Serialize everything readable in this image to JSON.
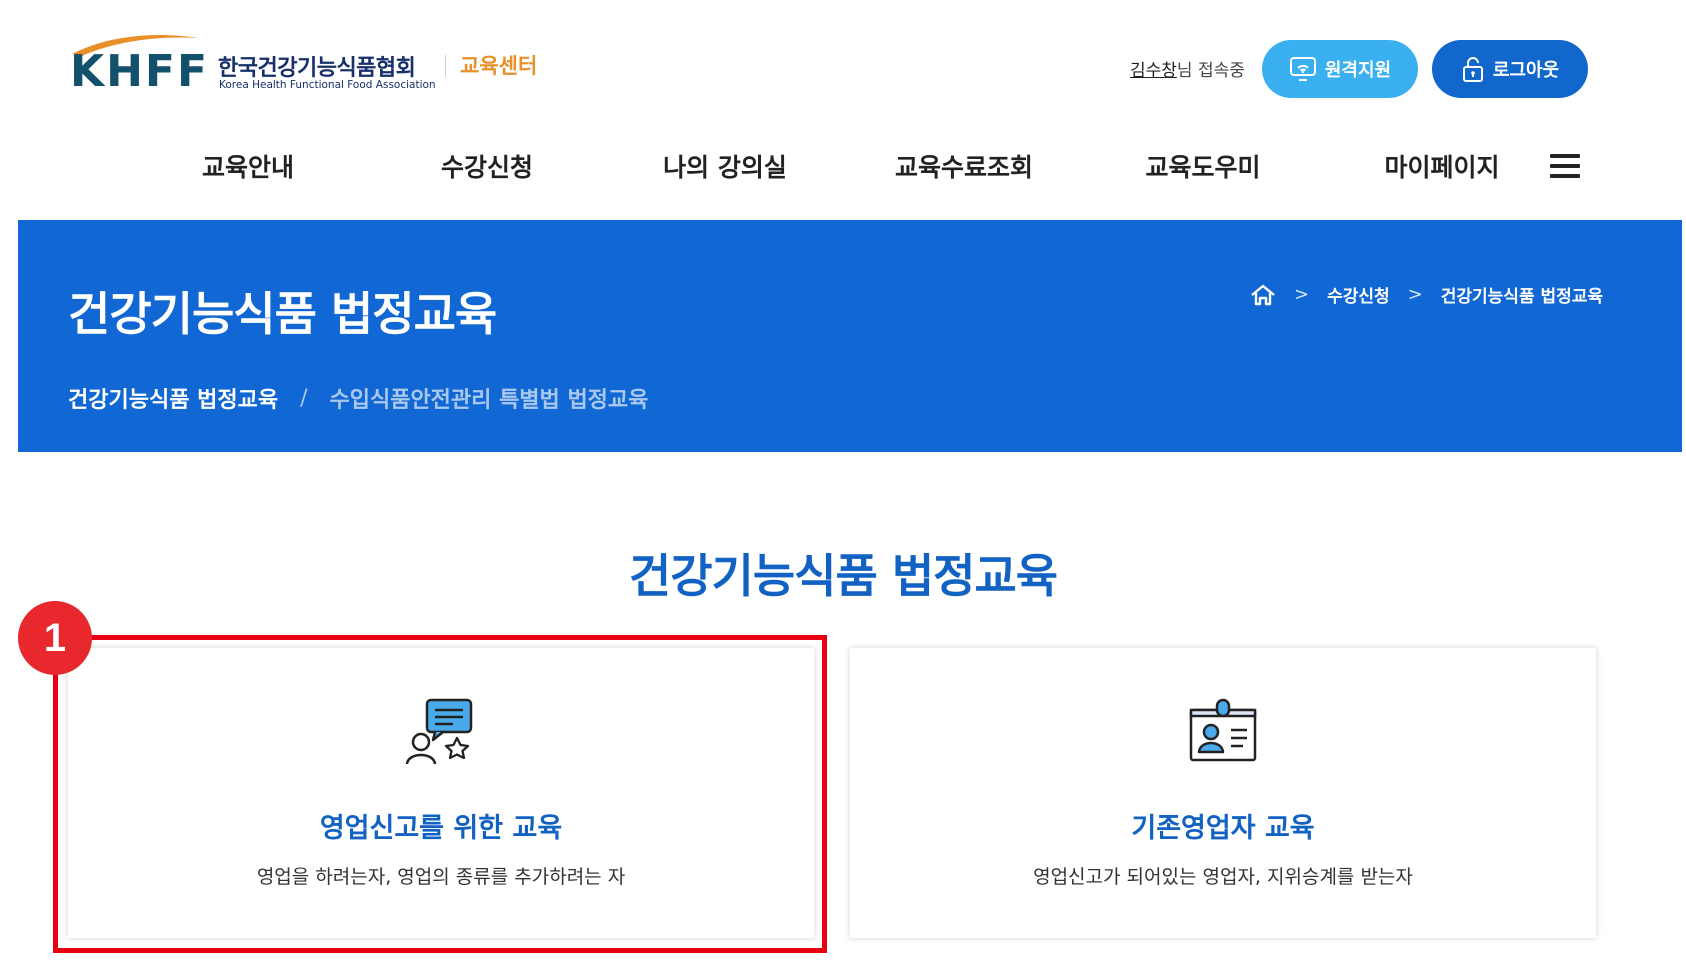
{
  "header": {
    "logo_text": "KHFF",
    "org_name_ko": "한국건강기능식품협회",
    "org_name_en": "Korea Health Functional Food Association",
    "center_label": "교육센터",
    "user_name": "김수창",
    "user_suffix": "님 접속중",
    "remote_support_label": "원격지원",
    "logout_label": "로그아웃"
  },
  "nav": {
    "items": [
      {
        "label": "교육안내"
      },
      {
        "label": "수강신청"
      },
      {
        "label": "나의 강의실"
      },
      {
        "label": "교육수료조회"
      },
      {
        "label": "교육도우미"
      },
      {
        "label": "마이페이지"
      }
    ],
    "menu_icon": "hamburger-icon"
  },
  "banner": {
    "title": "건강기능식품 법정교육",
    "breadcrumb": [
      "수강신청",
      "건강기능식품 법정교육"
    ],
    "subtabs": {
      "active": "건강기능식품 법정교육",
      "separator": "/",
      "inactive": "수입식품안전관리 특별법 법정교육"
    }
  },
  "section": {
    "title": "건강기능식품 법정교육",
    "cards": [
      {
        "icon": "certificate-user-icon",
        "title": "영업신고를 위한 교육",
        "desc": "영업을 하려는자, 영업의 종류를 추가하려는 자"
      },
      {
        "icon": "id-badge-icon",
        "title": "기존영업자 교육",
        "desc": "영업신고가 되어있는 영업자, 지위승계를 받는자"
      }
    ]
  },
  "annotation": {
    "step": "1",
    "color": "#e60012"
  },
  "colors": {
    "brand_blue": "#1167d3",
    "title_blue": "#1262c4",
    "accent_orange": "#e8902a",
    "sky_blue": "#3ab0f0"
  }
}
